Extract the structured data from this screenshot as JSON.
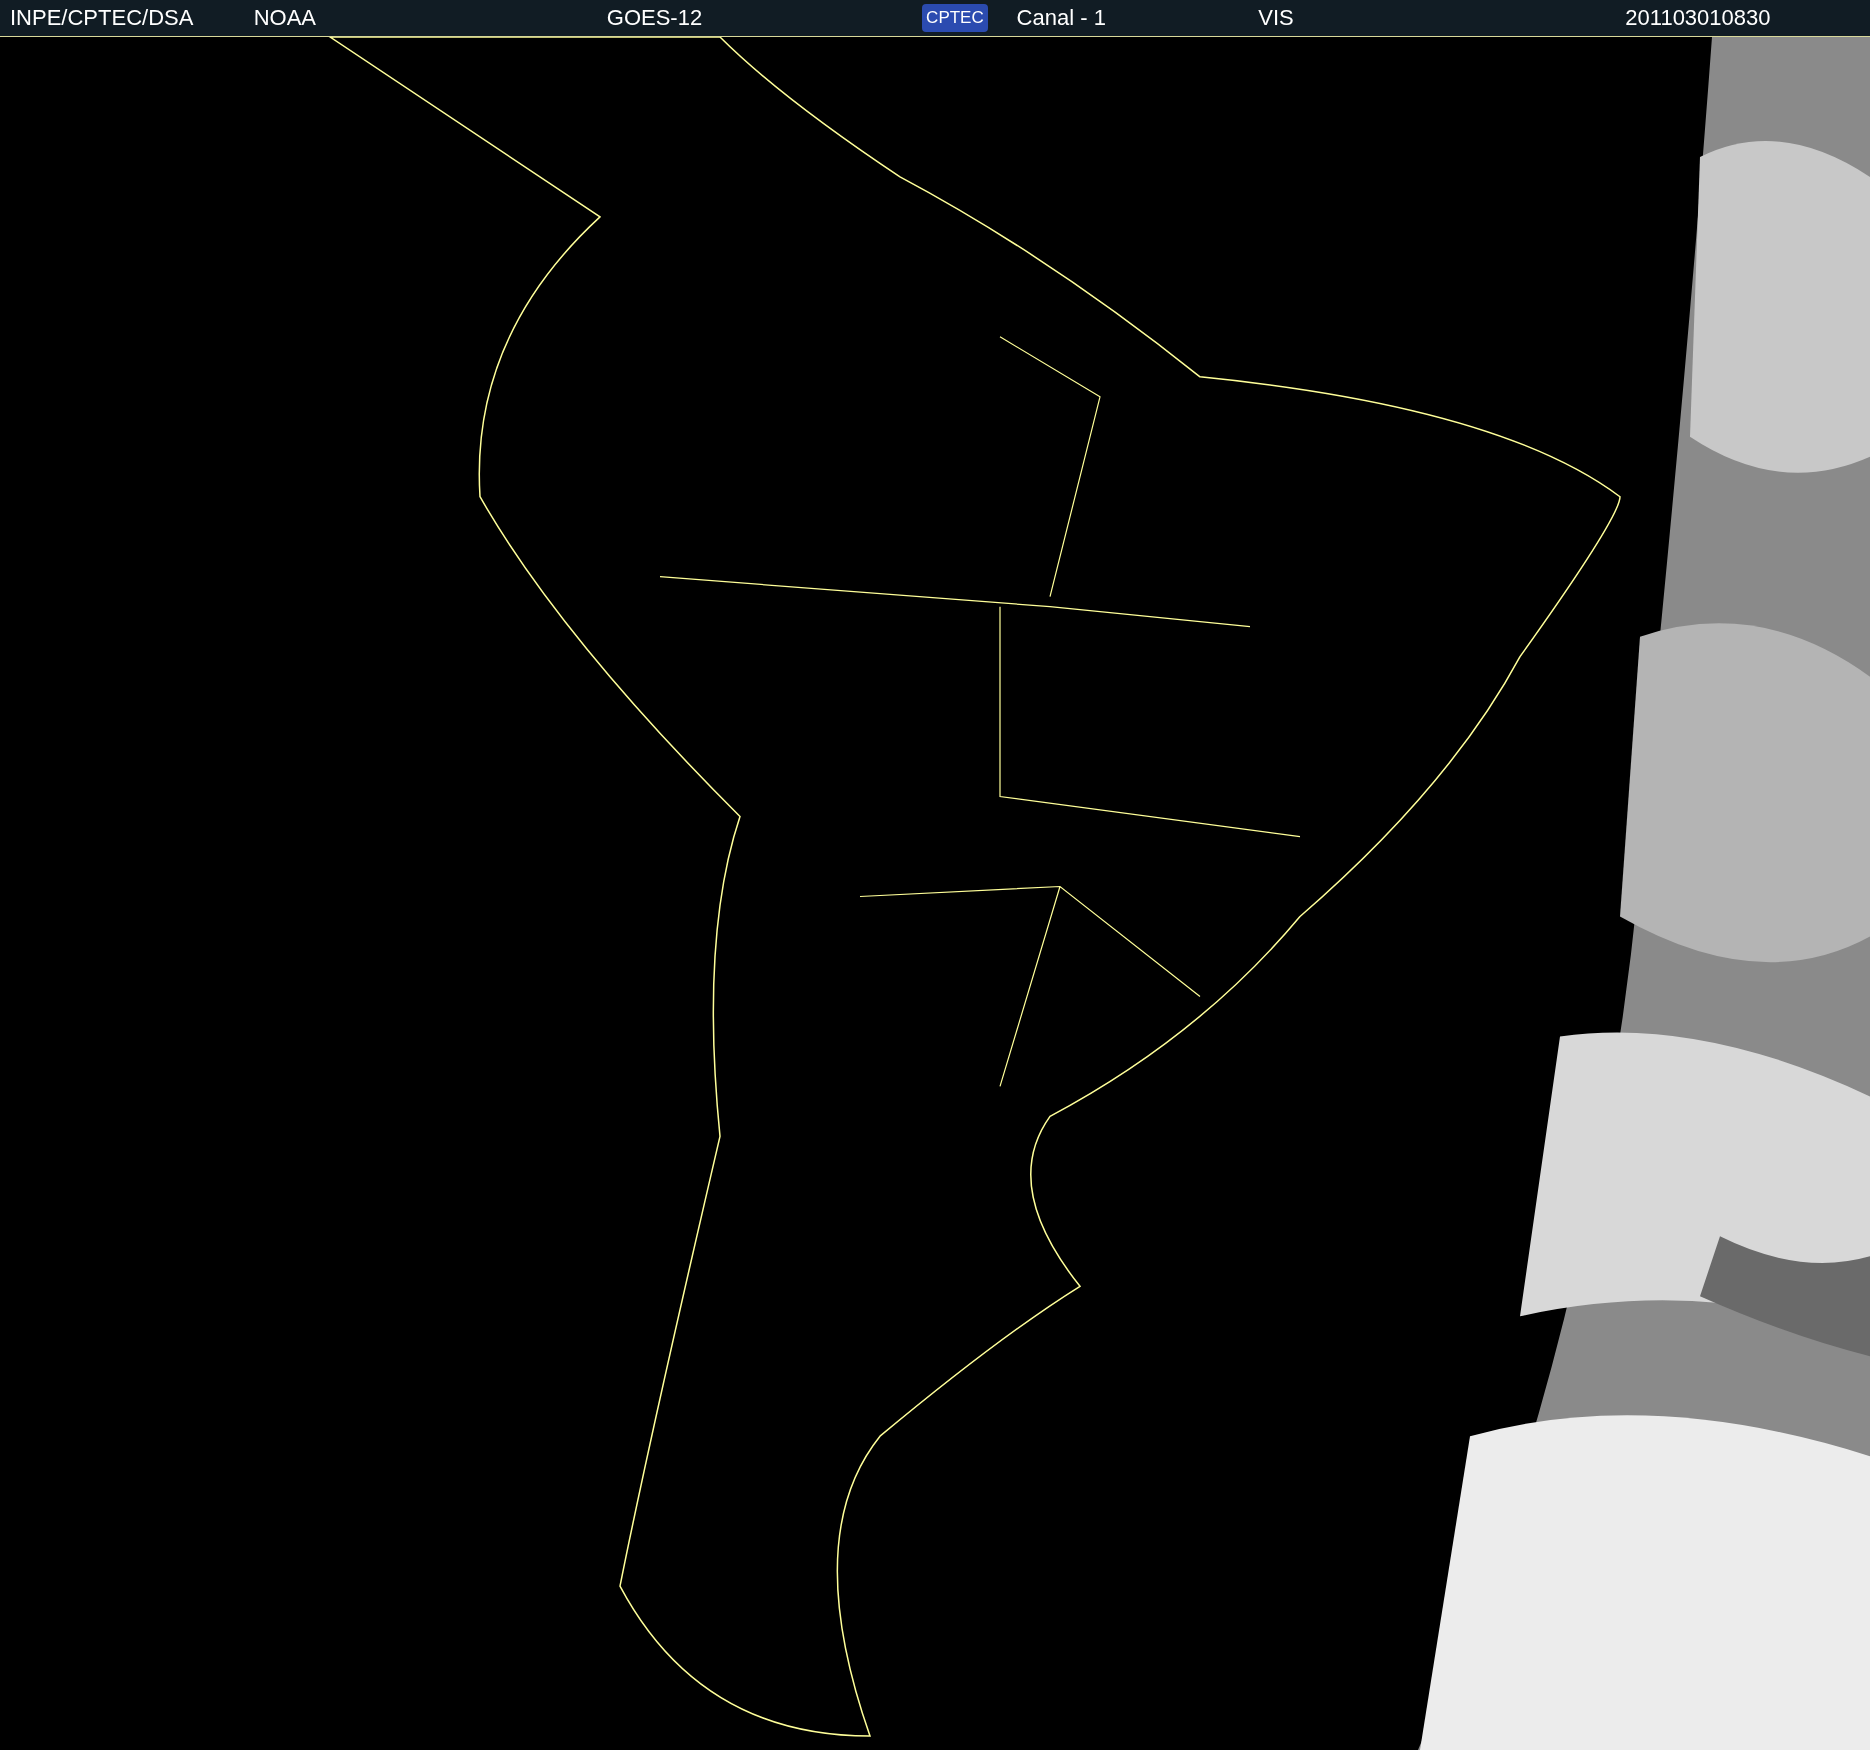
{
  "header": {
    "items": [
      {
        "kind": "text",
        "text": "INPE/CPTEC/DSA"
      },
      {
        "kind": "text",
        "text": "NOAA"
      },
      {
        "kind": "text",
        "text": "GOES-12"
      },
      {
        "kind": "logo",
        "text": "CPTEC"
      },
      {
        "kind": "text",
        "text": "Canal - 1"
      },
      {
        "kind": "text",
        "text": "VIS"
      },
      {
        "kind": "text",
        "text": "201103010830"
      }
    ]
  }
}
